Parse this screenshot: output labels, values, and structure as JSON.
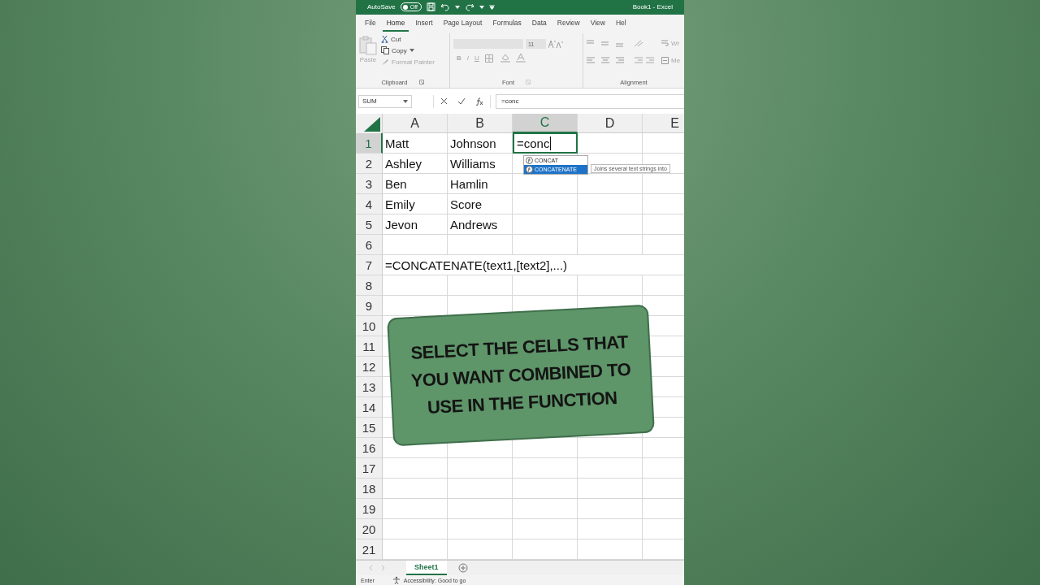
{
  "title_bar": {
    "autosave_label": "AutoSave",
    "autosave_toggle": {
      "label": "Off",
      "on": false
    },
    "title": "Book1 - Excel"
  },
  "ribbon_tabs": [
    {
      "label": "File",
      "selected": false
    },
    {
      "label": "Home",
      "selected": true
    },
    {
      "label": "Insert",
      "selected": false
    },
    {
      "label": "Page Layout",
      "selected": false
    },
    {
      "label": "Formulas",
      "selected": false
    },
    {
      "label": "Data",
      "selected": false
    },
    {
      "label": "Review",
      "selected": false
    },
    {
      "label": "View",
      "selected": false
    },
    {
      "label": "Hel",
      "selected": false
    }
  ],
  "ribbon": {
    "clipboard": {
      "paste": "Paste",
      "cut": "Cut",
      "copy": "Copy",
      "format_painter": "Format Painter",
      "group": "Clipboard"
    },
    "font": {
      "size": "11",
      "bold": "B",
      "italic": "I",
      "underline": "U",
      "group": "Font"
    },
    "alignment": {
      "wrap": "Wr",
      "merge": "Me",
      "group": "Alignment"
    }
  },
  "formula_bar": {
    "name_box": "SUM",
    "formula": "=conc"
  },
  "sheet": {
    "columns": [
      {
        "label": "A",
        "selected": false
      },
      {
        "label": "B",
        "selected": false
      },
      {
        "label": "C",
        "selected": true
      },
      {
        "label": "D",
        "selected": false
      },
      {
        "label": "E",
        "selected": false
      }
    ],
    "rows": [
      {
        "number": "1",
        "selected": true,
        "cells": [
          "Matt",
          "Johnson",
          "=conc"
        ]
      },
      {
        "number": "2",
        "selected": false,
        "cells": [
          "Ashley",
          "Williams"
        ]
      },
      {
        "number": "3",
        "selected": false,
        "cells": [
          "Ben",
          "Hamlin"
        ]
      },
      {
        "number": "4",
        "selected": false,
        "cells": [
          "Emily",
          "Score"
        ]
      },
      {
        "number": "5",
        "selected": false,
        "cells": [
          "Jevon",
          "Andrews"
        ]
      },
      {
        "number": "6",
        "selected": false
      },
      {
        "number": "7",
        "selected": false,
        "cells": [
          "=CONCATENATE(text1,[text2],...)"
        ]
      },
      {
        "number": "8",
        "selected": false
      },
      {
        "number": "9",
        "selected": false
      },
      {
        "number": "10",
        "selected": false
      },
      {
        "number": "11",
        "selected": false
      },
      {
        "number": "12",
        "selected": false
      },
      {
        "number": "13",
        "selected": false
      },
      {
        "number": "14",
        "selected": false
      },
      {
        "number": "15",
        "selected": false
      },
      {
        "number": "16",
        "selected": false
      },
      {
        "number": "17",
        "selected": false
      },
      {
        "number": "18",
        "selected": false
      },
      {
        "number": "19",
        "selected": false
      },
      {
        "number": "20",
        "selected": false
      },
      {
        "number": "21",
        "selected": false
      }
    ]
  },
  "autocomplete": {
    "items": [
      {
        "label": "CONCAT",
        "selected": false
      },
      {
        "label": "CONCATENATE",
        "selected": true
      }
    ],
    "tooltip": "Joins several text strings into"
  },
  "caption": {
    "lines": [
      "SELECT THE CELLS THAT",
      "YOU WANT COMBINED TO",
      "USE IN THE FUNCTION"
    ]
  },
  "sheet_tabs": [
    {
      "label": "Sheet1",
      "selected": true
    }
  ],
  "status_bar": {
    "mode": "Enter",
    "accessibility": "Accessibility: Good to go"
  }
}
